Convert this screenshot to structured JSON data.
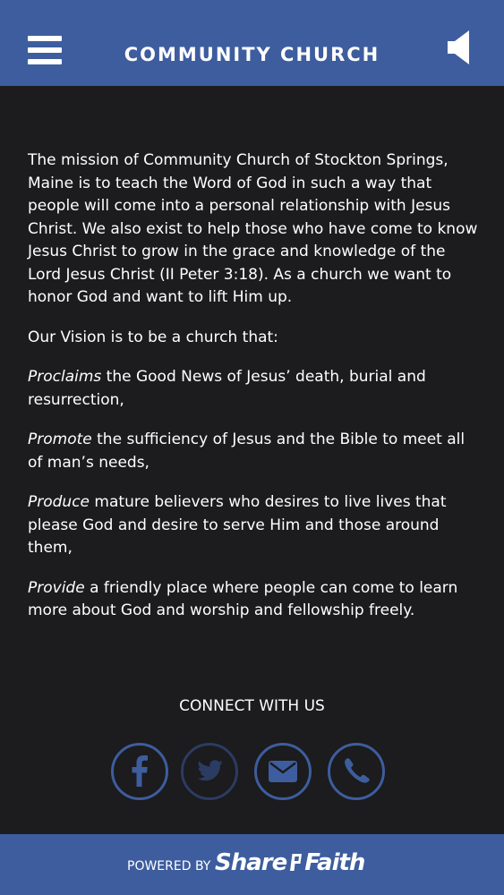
{
  "header": {
    "title": "COMMUNITY CHURCH",
    "menu_icon": "hamburger-menu-icon",
    "audio_icon": "speaker-icon"
  },
  "content": {
    "mission": "The mission of Community Church of Stockton Springs, Maine is to teach the Word of God in such a way that people will come into a personal relationship with Jesus Christ. We also exist to help those who have come to know Jesus Christ to grow in the grace and knowledge of the Lord Jesus Christ (II Peter 3:18). As a church we want to honor God and want to lift Him up.",
    "vision_intro": "Our Vision is to be a church that:",
    "vision_items": [
      {
        "keyword": "Proclaims",
        "text": " the Good News of Jesus’ death, burial and resurrection,"
      },
      {
        "keyword": "Promote",
        "text": " the sufficiency of Jesus and the Bible to meet all of man’s needs,"
      },
      {
        "keyword": "Produce",
        "text": " mature believers who desires to live lives that please God and desire to serve Him and those around them,"
      },
      {
        "keyword": "Provide",
        "text": " a friendly place where people can come to learn more about God and worship and fellowship freely."
      }
    ]
  },
  "connect": {
    "title": "CONNECT WITH US",
    "icons": [
      "facebook-icon",
      "twitter-icon",
      "email-icon",
      "phone-icon"
    ]
  },
  "footer": {
    "powered_by": "POWERED BY",
    "brand_part1": "Share",
    "brand_part2": "Faith"
  },
  "colors": {
    "header_bg": "#3d5d9e",
    "page_bg": "#1c1b1d",
    "text": "#ffffff",
    "accent": "#3d5d9e"
  }
}
